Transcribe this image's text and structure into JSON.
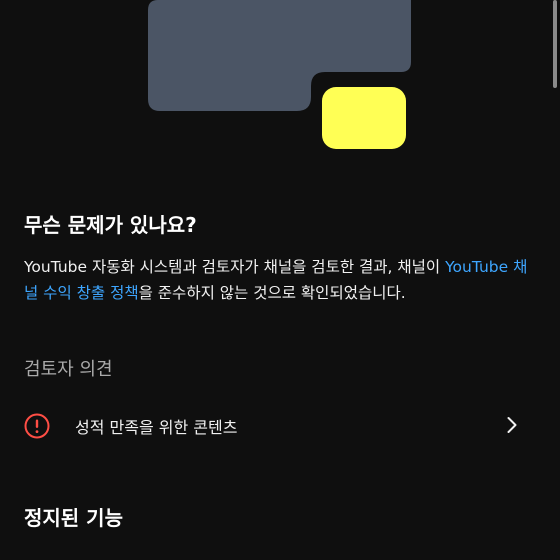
{
  "colors": {
    "background": "#0f0f0f",
    "link": "#3ea6ff",
    "alert": "#ff4e45",
    "illustration_primary": "#4b5565",
    "illustration_accent": "#ffff55"
  },
  "illustration": {
    "icon": "abstract-shapes-illustration"
  },
  "issue": {
    "heading": "무슨 문제가 있나요?",
    "description_before": "YouTube 자동화 시스템과 검토자가 채널을 검토한 결과, 채널이 ",
    "policy_link": "YouTube 채널 수익 창출 정책",
    "description_after": "을 준수하지 않는 것으로 확인되었습니다."
  },
  "reviewer": {
    "label": "검토자 의견",
    "items": [
      {
        "icon": "alert-circle-icon",
        "label": "성적 만족을 위한 콘텐츠",
        "chevron": "chevron-right-icon"
      }
    ]
  },
  "suspended": {
    "heading": "정지된 기능"
  }
}
